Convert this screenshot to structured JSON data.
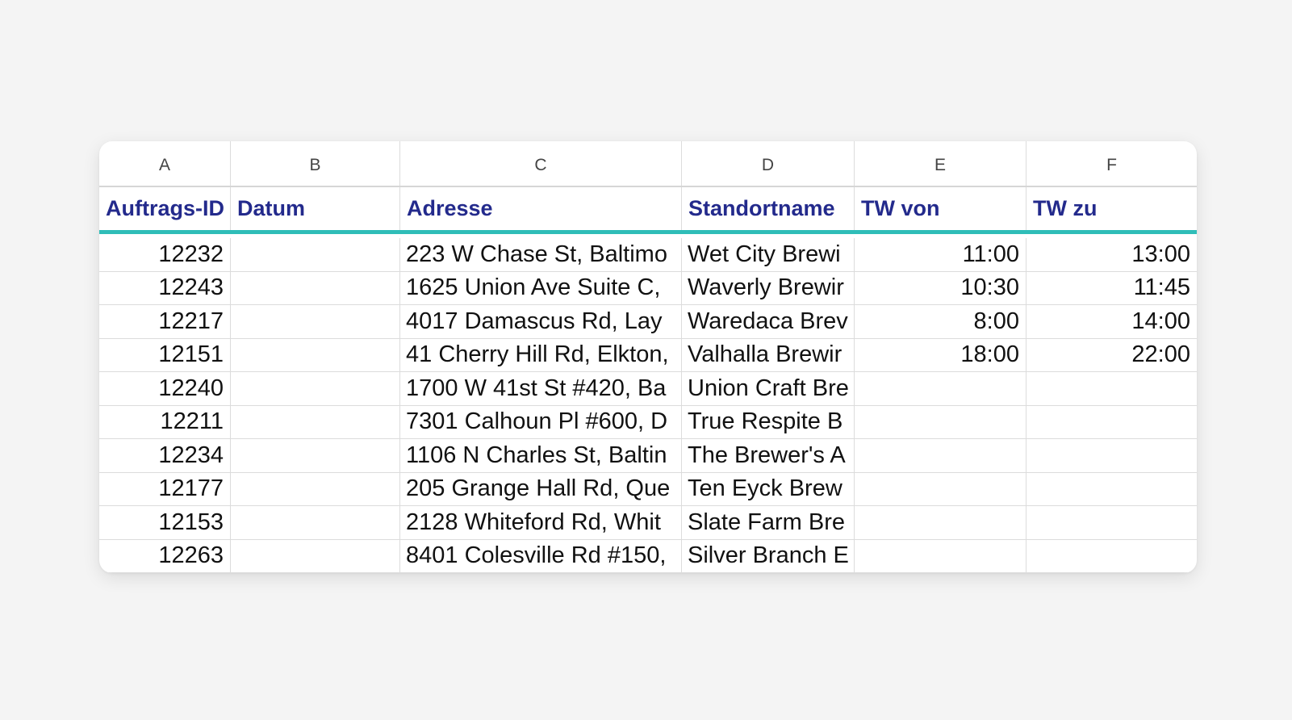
{
  "columns": [
    "A",
    "B",
    "C",
    "D",
    "E",
    "F"
  ],
  "headers": {
    "auftrags_id": "Auftrags-ID",
    "datum": "Datum",
    "adresse": "Adresse",
    "standortname": "Standortname",
    "tw_von": "TW von",
    "tw_zu": "TW zu"
  },
  "rows": [
    {
      "id": "12232",
      "datum": "",
      "adresse": "223 W Chase St, Baltimo",
      "standort": "Wet City Brewi",
      "von": "11:00",
      "zu": "13:00"
    },
    {
      "id": "12243",
      "datum": "",
      "adresse": "1625 Union Ave Suite C,",
      "standort": "Waverly Brewir",
      "von": "10:30",
      "zu": "11:45"
    },
    {
      "id": "12217",
      "datum": "",
      "adresse": "4017 Damascus Rd, Lay",
      "standort": "Waredaca Brev",
      "von": "8:00",
      "zu": "14:00"
    },
    {
      "id": "12151",
      "datum": "",
      "adresse": "41 Cherry Hill Rd, Elkton,",
      "standort": "Valhalla Brewir",
      "von": "18:00",
      "zu": "22:00"
    },
    {
      "id": "12240",
      "datum": "",
      "adresse": "1700 W 41st St #420, Ba",
      "standort": "Union Craft Bre",
      "von": "",
      "zu": ""
    },
    {
      "id": "12211",
      "datum": "",
      "adresse": "7301 Calhoun Pl #600, D",
      "standort": "True Respite B",
      "von": "",
      "zu": ""
    },
    {
      "id": "12234",
      "datum": "",
      "adresse": "1106 N Charles St, Baltin",
      "standort": "The Brewer's A",
      "von": "",
      "zu": ""
    },
    {
      "id": "12177",
      "datum": "",
      "adresse": "205 Grange Hall Rd, Que",
      "standort": "Ten Eyck Brew",
      "von": "",
      "zu": ""
    },
    {
      "id": "12153",
      "datum": "",
      "adresse": "2128 Whiteford Rd, Whit",
      "standort": "Slate Farm Bre",
      "von": "",
      "zu": ""
    },
    {
      "id": "12263",
      "datum": "",
      "adresse": "8401 Colesville Rd #150,",
      "standort": "Silver Branch E",
      "von": "",
      "zu": ""
    }
  ],
  "colors": {
    "header_text": "#232a8c",
    "header_underline": "#2fbdb8",
    "grid_line": "#dcdcdc",
    "background": "#f4f4f4"
  }
}
